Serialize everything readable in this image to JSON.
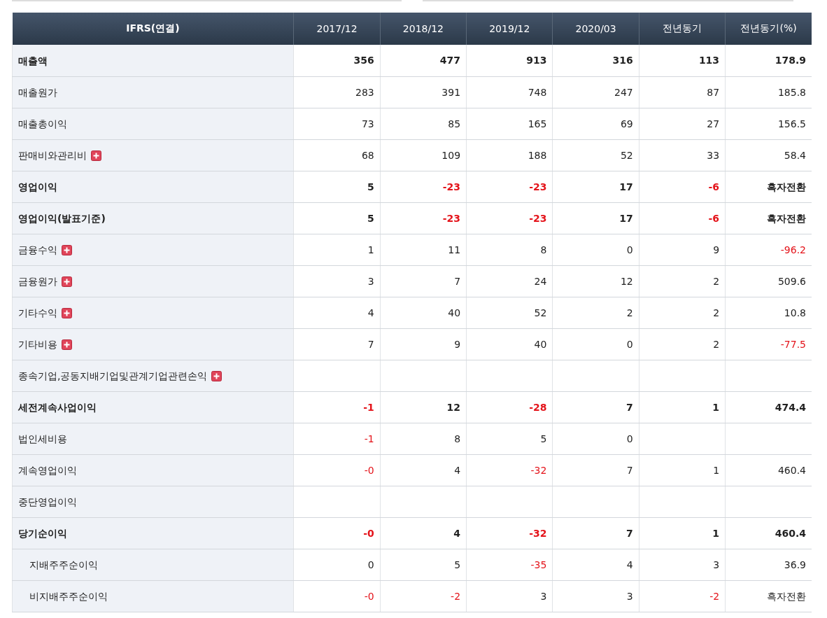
{
  "table": {
    "label_header": "IFRS(연결)",
    "columns": [
      "2017/12",
      "2018/12",
      "2019/12",
      "2020/03",
      "전년동기",
      "전년동기(%)"
    ],
    "rows": [
      {
        "label": "매출액",
        "bold": true,
        "expandable": false,
        "cells": [
          {
            "v": "356",
            "neg": false
          },
          {
            "v": "477",
            "neg": false
          },
          {
            "v": "913",
            "neg": false
          },
          {
            "v": "316",
            "neg": false
          },
          {
            "v": "113",
            "neg": false
          },
          {
            "v": "178.9",
            "neg": false
          }
        ]
      },
      {
        "label": "매출원가",
        "bold": false,
        "expandable": false,
        "cells": [
          {
            "v": "283",
            "neg": false
          },
          {
            "v": "391",
            "neg": false
          },
          {
            "v": "748",
            "neg": false
          },
          {
            "v": "247",
            "neg": false
          },
          {
            "v": "87",
            "neg": false
          },
          {
            "v": "185.8",
            "neg": false
          }
        ]
      },
      {
        "label": "매출총이익",
        "bold": false,
        "expandable": false,
        "cells": [
          {
            "v": "73",
            "neg": false
          },
          {
            "v": "85",
            "neg": false
          },
          {
            "v": "165",
            "neg": false
          },
          {
            "v": "69",
            "neg": false
          },
          {
            "v": "27",
            "neg": false
          },
          {
            "v": "156.5",
            "neg": false
          }
        ]
      },
      {
        "label": "판매비와관리비",
        "bold": false,
        "expandable": true,
        "cells": [
          {
            "v": "68",
            "neg": false
          },
          {
            "v": "109",
            "neg": false
          },
          {
            "v": "188",
            "neg": false
          },
          {
            "v": "52",
            "neg": false
          },
          {
            "v": "33",
            "neg": false
          },
          {
            "v": "58.4",
            "neg": false
          }
        ]
      },
      {
        "label": "영업이익",
        "bold": true,
        "expandable": false,
        "cells": [
          {
            "v": "5",
            "neg": false
          },
          {
            "v": "-23",
            "neg": true
          },
          {
            "v": "-23",
            "neg": true
          },
          {
            "v": "17",
            "neg": false
          },
          {
            "v": "-6",
            "neg": true
          },
          {
            "v": "흑자전환",
            "neg": false
          }
        ]
      },
      {
        "label": "영업이익(발표기준)",
        "bold": true,
        "expandable": false,
        "cells": [
          {
            "v": "5",
            "neg": false
          },
          {
            "v": "-23",
            "neg": true
          },
          {
            "v": "-23",
            "neg": true
          },
          {
            "v": "17",
            "neg": false
          },
          {
            "v": "-6",
            "neg": true
          },
          {
            "v": "흑자전환",
            "neg": false
          }
        ]
      },
      {
        "label": "금융수익",
        "bold": false,
        "expandable": true,
        "cells": [
          {
            "v": "1",
            "neg": false
          },
          {
            "v": "11",
            "neg": false
          },
          {
            "v": "8",
            "neg": false
          },
          {
            "v": "0",
            "neg": false
          },
          {
            "v": "9",
            "neg": false
          },
          {
            "v": "-96.2",
            "neg": true
          }
        ]
      },
      {
        "label": "금융원가",
        "bold": false,
        "expandable": true,
        "cells": [
          {
            "v": "3",
            "neg": false
          },
          {
            "v": "7",
            "neg": false
          },
          {
            "v": "24",
            "neg": false
          },
          {
            "v": "12",
            "neg": false
          },
          {
            "v": "2",
            "neg": false
          },
          {
            "v": "509.6",
            "neg": false
          }
        ]
      },
      {
        "label": "기타수익",
        "bold": false,
        "expandable": true,
        "cells": [
          {
            "v": "4",
            "neg": false
          },
          {
            "v": "40",
            "neg": false
          },
          {
            "v": "52",
            "neg": false
          },
          {
            "v": "2",
            "neg": false
          },
          {
            "v": "2",
            "neg": false
          },
          {
            "v": "10.8",
            "neg": false
          }
        ]
      },
      {
        "label": "기타비용",
        "bold": false,
        "expandable": true,
        "cells": [
          {
            "v": "7",
            "neg": false
          },
          {
            "v": "9",
            "neg": false
          },
          {
            "v": "40",
            "neg": false
          },
          {
            "v": "0",
            "neg": false
          },
          {
            "v": "2",
            "neg": false
          },
          {
            "v": "-77.5",
            "neg": true
          }
        ]
      },
      {
        "label": "종속기업,공동지배기업및관계기업관련손익",
        "bold": false,
        "expandable": true,
        "cells": [
          null,
          null,
          null,
          null,
          null,
          null
        ]
      },
      {
        "label": "세전계속사업이익",
        "bold": true,
        "expandable": false,
        "cells": [
          {
            "v": "-1",
            "neg": true
          },
          {
            "v": "12",
            "neg": false
          },
          {
            "v": "-28",
            "neg": true
          },
          {
            "v": "7",
            "neg": false
          },
          {
            "v": "1",
            "neg": false
          },
          {
            "v": "474.4",
            "neg": false
          }
        ]
      },
      {
        "label": "법인세비용",
        "bold": false,
        "expandable": false,
        "cells": [
          {
            "v": "-1",
            "neg": true
          },
          {
            "v": "8",
            "neg": false
          },
          {
            "v": "5",
            "neg": false
          },
          {
            "v": "0",
            "neg": false
          },
          null,
          null
        ]
      },
      {
        "label": "계속영업이익",
        "bold": false,
        "expandable": false,
        "cells": [
          {
            "v": "-0",
            "neg": true
          },
          {
            "v": "4",
            "neg": false
          },
          {
            "v": "-32",
            "neg": true
          },
          {
            "v": "7",
            "neg": false
          },
          {
            "v": "1",
            "neg": false
          },
          {
            "v": "460.4",
            "neg": false
          }
        ]
      },
      {
        "label": "중단영업이익",
        "bold": false,
        "expandable": false,
        "cells": [
          null,
          null,
          null,
          null,
          null,
          null
        ]
      },
      {
        "label": "당기순이익",
        "bold": true,
        "expandable": false,
        "cells": [
          {
            "v": "-0",
            "neg": true
          },
          {
            "v": "4",
            "neg": false
          },
          {
            "v": "-32",
            "neg": true
          },
          {
            "v": "7",
            "neg": false
          },
          {
            "v": "1",
            "neg": false
          },
          {
            "v": "460.4",
            "neg": false
          }
        ],
        "children": [
          {
            "label": "지배주주순이익",
            "bold": false,
            "expandable": false,
            "cells": [
              {
                "v": "0",
                "neg": false
              },
              {
                "v": "5",
                "neg": false
              },
              {
                "v": "-35",
                "neg": true
              },
              {
                "v": "4",
                "neg": false
              },
              {
                "v": "3",
                "neg": false
              },
              {
                "v": "36.9",
                "neg": false
              }
            ]
          },
          {
            "label": "비지배주주순이익",
            "bold": false,
            "expandable": false,
            "cells": [
              {
                "v": "-0",
                "neg": true
              },
              {
                "v": "-2",
                "neg": true
              },
              {
                "v": "3",
                "neg": false
              },
              {
                "v": "3",
                "neg": false
              },
              {
                "v": "-2",
                "neg": true
              },
              {
                "v": "흑자전환",
                "neg": false
              }
            ]
          }
        ]
      }
    ]
  }
}
